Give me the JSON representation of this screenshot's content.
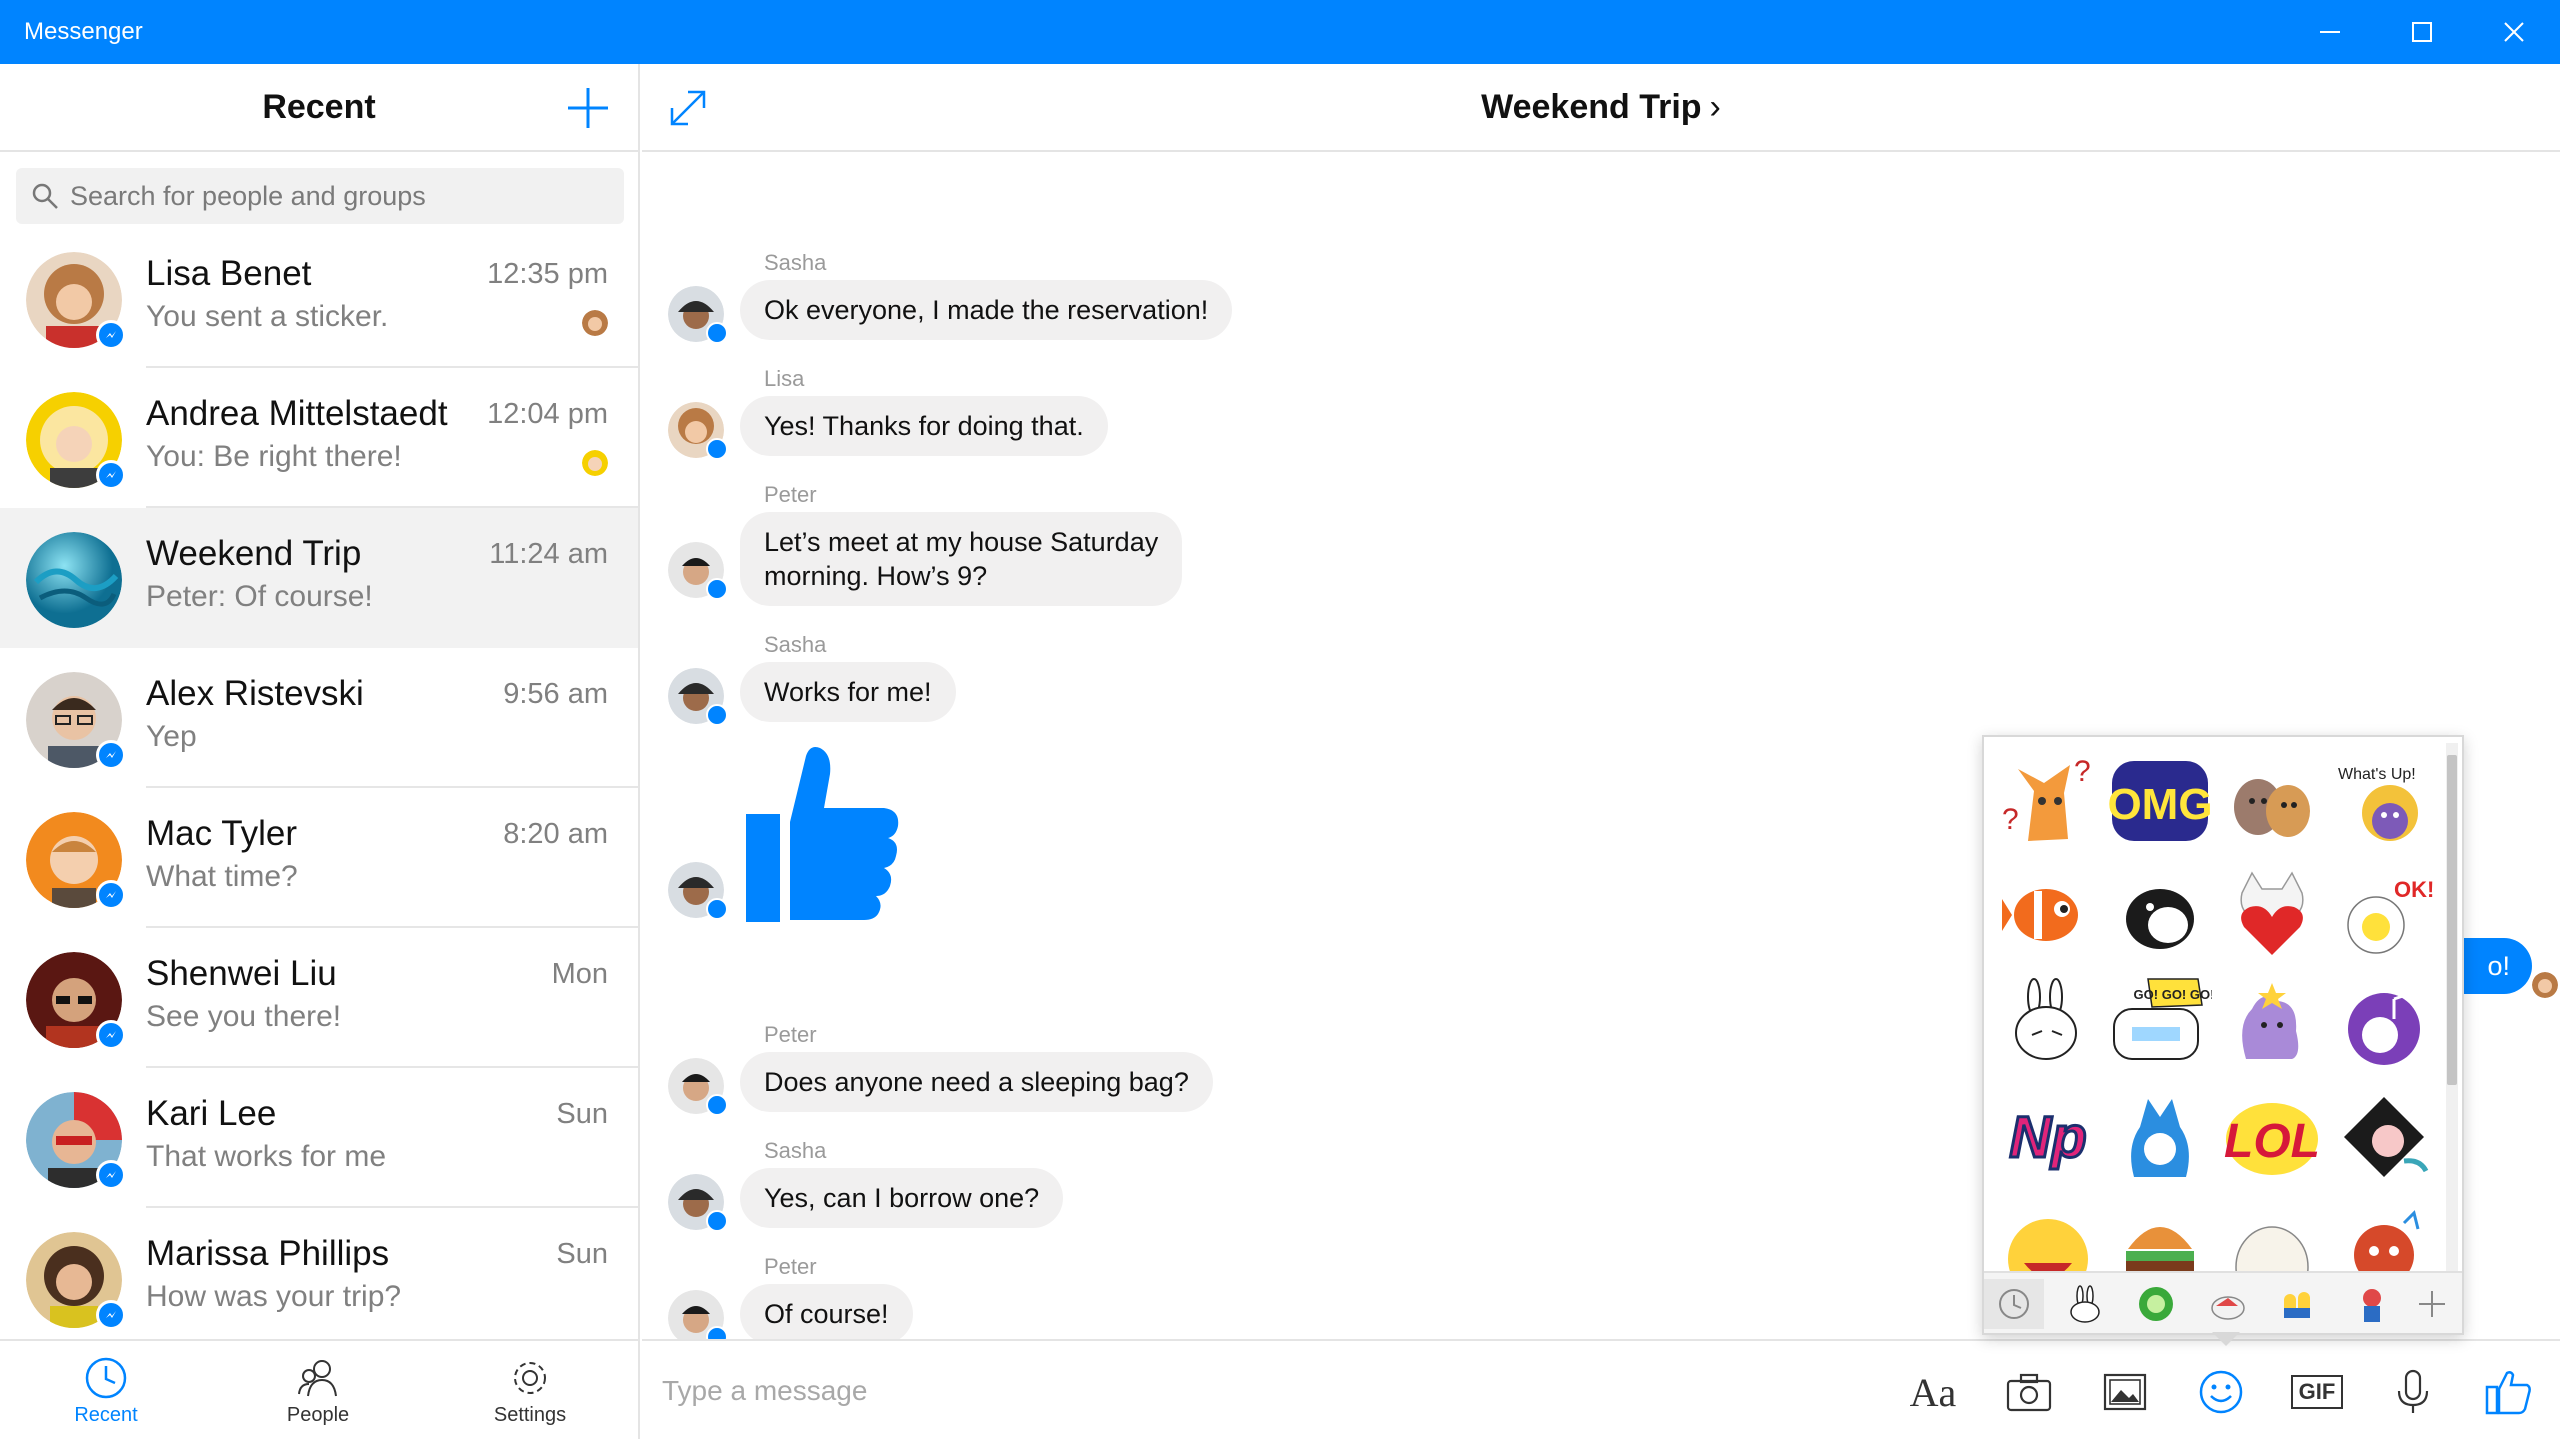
{
  "window": {
    "title": "Messenger"
  },
  "left": {
    "title": "Recent",
    "search_placeholder": "Search for people and groups",
    "conversations": [
      {
        "name": "Lisa Benet",
        "preview": "You sent a sticker.",
        "time": "12:35 pm",
        "avatar": "#c98f58"
      },
      {
        "name": "Andrea Mittelstaedt",
        "preview": "You: Be right there!",
        "time": "12:04 pm",
        "avatar": "#f2c200"
      },
      {
        "name": "Weekend Trip",
        "preview": "Peter: Of course!",
        "time": "11:24 am",
        "avatar": "#2aa9c9"
      },
      {
        "name": "Alex Ristevski",
        "preview": "Yep",
        "time": "9:56 am",
        "avatar": "#8a7b6e"
      },
      {
        "name": "Mac Tyler",
        "preview": "What time?",
        "time": "8:20 am",
        "avatar": "#f08a1c"
      },
      {
        "name": "Shenwei Liu",
        "preview": "See you there!",
        "time": "Mon",
        "avatar": "#a8301e"
      },
      {
        "name": "Kari Lee",
        "preview": "That works for me",
        "time": "Sun",
        "avatar": "#3c6f8e"
      },
      {
        "name": "Marissa Phillips",
        "preview": "How was your trip?",
        "time": "Sun",
        "avatar": "#d9a64c"
      }
    ],
    "nav": {
      "recent": "Recent",
      "people": "People",
      "settings": "Settings"
    }
  },
  "chat": {
    "title": "Weekend Trip",
    "messages": [
      {
        "sender": "Sasha",
        "text": "Ok everyone, I made the reservation!"
      },
      {
        "sender": "Lisa",
        "text": "Yes! Thanks for doing that."
      },
      {
        "sender": "Peter",
        "text": "Let’s meet at my house Saturday",
        "text2": "morning. How’s 9?"
      },
      {
        "sender": "Sasha",
        "text": "Works for me!"
      },
      {
        "sender": "Peter",
        "text": "Does anyone need a sleeping bag?"
      },
      {
        "sender": "Sasha",
        "text": "Yes, can I borrow one?"
      },
      {
        "sender": "Peter",
        "text": "Of course!"
      }
    ],
    "sent_partial": "o!",
    "composer_placeholder": "Type a message",
    "text_format_label": "Aa",
    "gif_label": "GIF"
  },
  "stickers": {
    "labels": {
      "omg": "OMG",
      "lol": "LOL",
      "np": "Np",
      "ok": "OK!!",
      "whats_up": "What's Up!",
      "go": "GO! GO! GO!"
    }
  },
  "colors": {
    "accent": "#0084ff",
    "bubble": "#f1f0f0",
    "muted": "#808080"
  }
}
